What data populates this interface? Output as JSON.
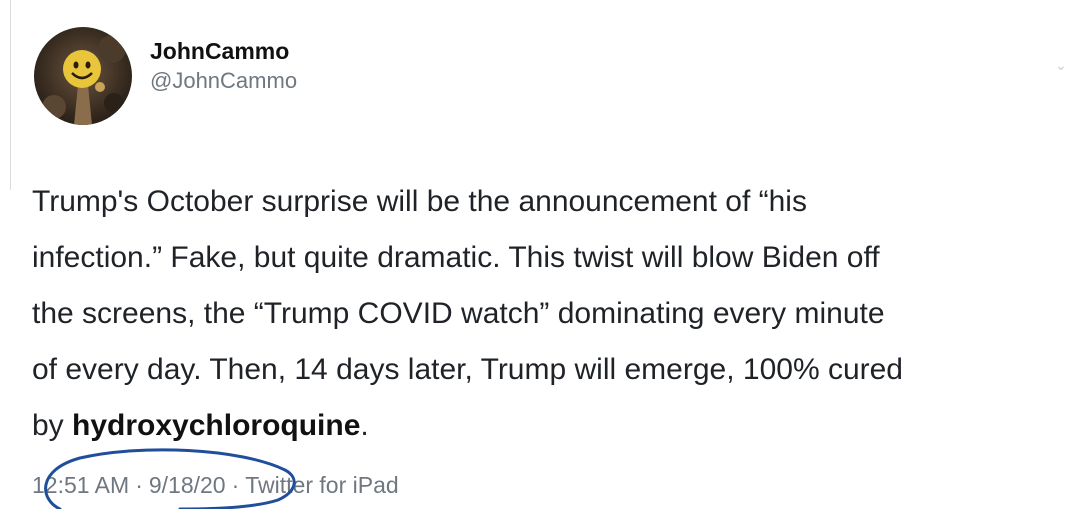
{
  "tweet": {
    "author": {
      "display_name": "JohnCammo",
      "handle": "@JohnCammo",
      "avatar_icon": "avatar-smiley-figure-icon"
    },
    "text_lines": [
      "Trump's October surprise will be the announcement of “his",
      "infection.”  Fake, but quite dramatic. This twist will blow Biden off",
      "the screens, the “Trump COVID watch” dominating every minute",
      "of every day.  Then, 14 days later, Trump will emerge, 100% cured"
    ],
    "last_line_prefix": "by ",
    "last_line_bold": "hydroxychloroquine",
    "last_line_suffix": ".",
    "time": "12:51 AM",
    "date": "9/18/20",
    "source": "Twitter for iPad",
    "separator": "·"
  },
  "colors": {
    "annotation_ink": "#1f4f9a",
    "meta_gray": "#6f7780"
  }
}
